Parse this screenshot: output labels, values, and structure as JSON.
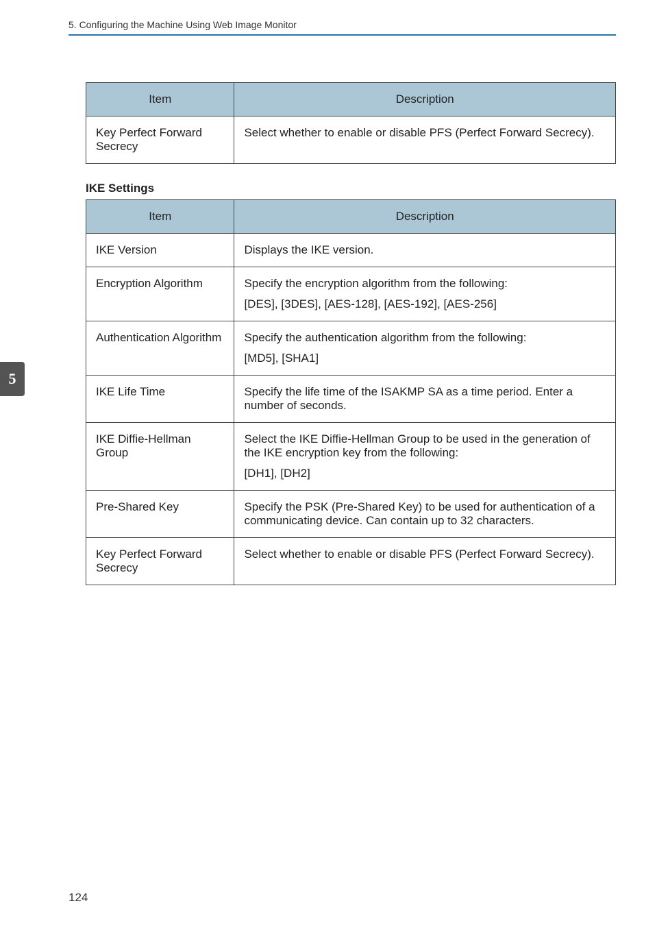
{
  "header": {
    "breadcrumb": "5. Configuring the Machine Using Web Image Monitor"
  },
  "sideTab": "5",
  "table1": {
    "headers": {
      "item": "Item",
      "description": "Description"
    },
    "rows": [
      {
        "item": "Key Perfect Forward Secrecy",
        "description": "Select whether to enable or disable PFS (Perfect Forward Secrecy)."
      }
    ]
  },
  "section2": {
    "title": "IKE Settings"
  },
  "table2": {
    "headers": {
      "item": "Item",
      "description": "Description"
    },
    "rows": [
      {
        "item": "IKE Version",
        "desc1": "Displays the IKE version."
      },
      {
        "item": "Encryption Algorithm",
        "desc1": "Specify the encryption algorithm from the following:",
        "desc2": "[DES], [3DES], [AES-128], [AES-192], [AES-256]"
      },
      {
        "item": "Authentication Algorithm",
        "desc1": "Specify the authentication algorithm from the following:",
        "desc2": "[MD5], [SHA1]"
      },
      {
        "item": "IKE Life Time",
        "desc1": "Specify the life time of the ISAKMP SA as a time period. Enter a number of seconds."
      },
      {
        "item": "IKE Diffie-Hellman Group",
        "desc1": "Select the IKE Diffie-Hellman Group to be used in the generation of the IKE encryption key from the following:",
        "desc2": "[DH1], [DH2]"
      },
      {
        "item": "Pre-Shared Key",
        "desc1": "Specify the PSK (Pre-Shared Key) to be used for authentication of a communicating device. Can contain up to 32 characters."
      },
      {
        "item": "Key Perfect Forward Secrecy",
        "desc1": "Select whether to enable or disable PFS (Perfect Forward Secrecy)."
      }
    ]
  },
  "pageNumber": "124"
}
